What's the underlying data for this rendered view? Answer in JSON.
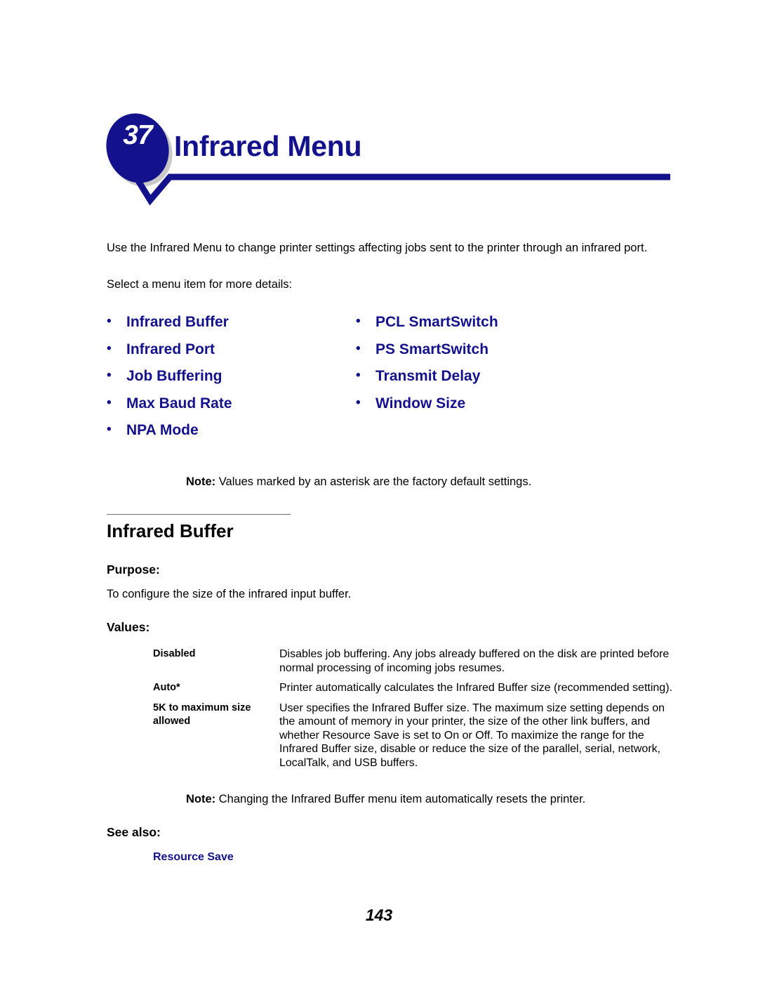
{
  "page": {
    "number": "143"
  },
  "header": {
    "badge_number": "37",
    "title": "Infrared Menu"
  },
  "intro": {
    "paragraph": "Use the Infrared Menu to change printer settings affecting jobs sent to the printer through an infrared port.",
    "select_prompt": "Select a menu item for more details:"
  },
  "menu_links": {
    "bullet": "•",
    "left_column": [
      {
        "label": "Infrared Buffer"
      },
      {
        "label": "Infrared Port"
      },
      {
        "label": "Job Buffering"
      },
      {
        "label": "Max Baud Rate"
      },
      {
        "label": "NPA Mode"
      }
    ],
    "right_column": [
      {
        "label": "PCL SmartSwitch"
      },
      {
        "label": "PS SmartSwitch"
      },
      {
        "label": "Transmit Delay"
      },
      {
        "label": "Window Size"
      }
    ]
  },
  "notes": {
    "top_label": "Note:",
    "top_text": "Values marked by an asterisk are the factory default settings.",
    "bottom_label": "Note:",
    "bottom_text": "Changing the Infrared Buffer menu item automatically resets the printer."
  },
  "section": {
    "heading": "Infrared Buffer",
    "purpose_label": "Purpose:",
    "purpose_text": "To configure the size of the infrared input buffer.",
    "values_label": "Values:",
    "see_also_label": "See also:",
    "see_also_link": "Resource Save"
  },
  "values": [
    {
      "label": "Disabled",
      "description": "Disables job buffering. Any jobs already buffered on the disk are printed before normal processing of incoming jobs resumes."
    },
    {
      "label": "Auto*",
      "description": "Printer automatically calculates the Infrared Buffer size (recommended setting)."
    },
    {
      "label": "5K to maximum size allowed",
      "description": "User specifies the Infrared Buffer size. The maximum size setting depends on the amount of memory in your printer, the size of the other link buffers, and whether Resource Save is set to On or Off. To maximize the range for the Infrared Buffer size, disable or reduce the size of the parallel, serial, network, LocalTalk, and USB buffers."
    }
  ],
  "colors": {
    "brand_navy": "#13128c",
    "link_navy": "#13128c",
    "rule_gray": "#6e6e6e",
    "badge_shadow": "#c9c9c9"
  }
}
